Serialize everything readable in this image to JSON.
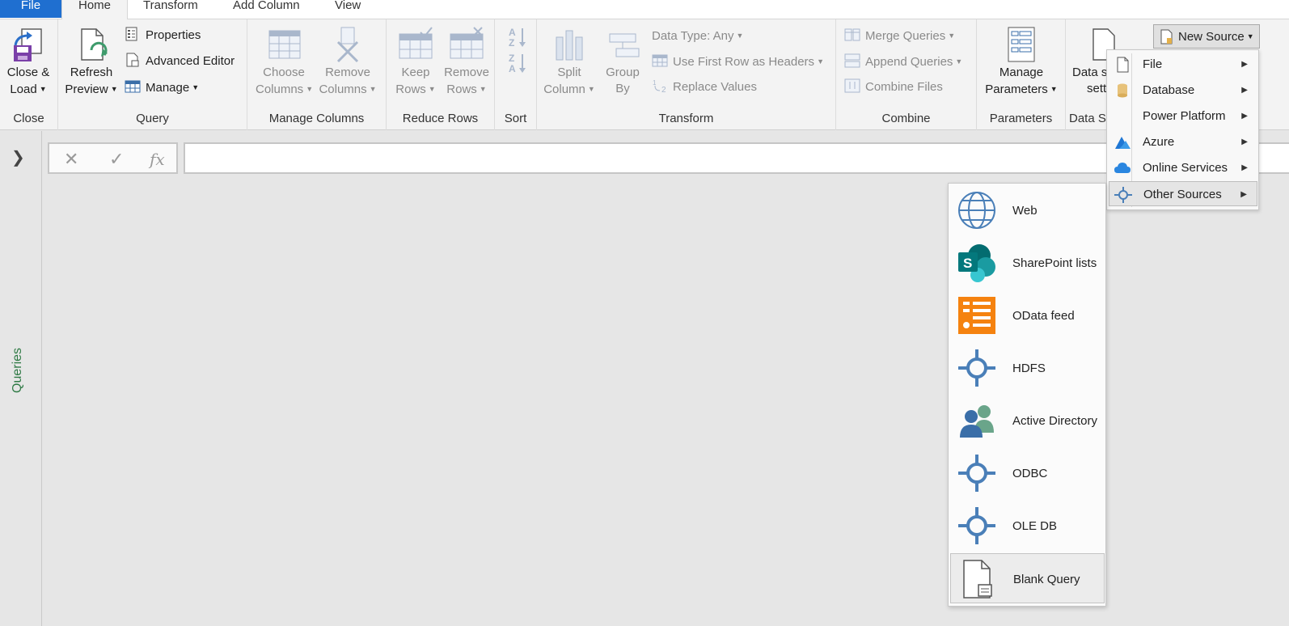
{
  "tabs": {
    "file": "File",
    "home": "Home",
    "transform": "Transform",
    "add_column": "Add Column",
    "view": "View"
  },
  "ribbon": {
    "close": {
      "button_line1": "Close &",
      "button_line2": "Load",
      "label": "Close"
    },
    "query": {
      "refresh_line1": "Refresh",
      "refresh_line2": "Preview",
      "properties": "Properties",
      "advanced_editor": "Advanced Editor",
      "manage": "Manage",
      "label": "Query"
    },
    "manage_columns": {
      "choose_line1": "Choose",
      "choose_line2": "Columns",
      "remove_line1": "Remove",
      "remove_line2": "Columns",
      "label": "Manage Columns"
    },
    "reduce_rows": {
      "keep_line1": "Keep",
      "keep_line2": "Rows",
      "remove_line1": "Remove",
      "remove_line2": "Rows",
      "label": "Reduce Rows"
    },
    "sort": {
      "label": "Sort"
    },
    "transform": {
      "split_line1": "Split",
      "split_line2": "Column",
      "group_line1": "Group",
      "group_line2": "By",
      "data_type": "Data Type: Any",
      "first_row_headers": "Use First Row as Headers",
      "replace_values": "Replace Values",
      "label": "Transform"
    },
    "combine": {
      "merge_queries": "Merge Queries",
      "append_queries": "Append Queries",
      "combine_files": "Combine Files",
      "label": "Combine"
    },
    "parameters": {
      "manage_line1": "Manage",
      "manage_line2": "Parameters",
      "label": "Parameters"
    },
    "data_sources": {
      "line1": "Data s",
      "line2": "setti",
      "label": "Data S"
    },
    "new_source": "New Source"
  },
  "queries_pane": {
    "label": "Queries"
  },
  "new_source_menu": {
    "items": [
      {
        "label": "File"
      },
      {
        "label": "Database"
      },
      {
        "label": "Power Platform"
      },
      {
        "label": "Azure"
      },
      {
        "label": "Online Services"
      },
      {
        "label": "Other Sources"
      }
    ]
  },
  "other_sources_submenu": {
    "items": [
      {
        "label": "Web"
      },
      {
        "label": "SharePoint lists"
      },
      {
        "label": "OData feed"
      },
      {
        "label": "HDFS"
      },
      {
        "label": "Active Directory"
      },
      {
        "label": "ODBC"
      },
      {
        "label": "OLE DB"
      },
      {
        "label": "Blank Query"
      }
    ]
  },
  "colors": {
    "file_tab": "#1f6fd0",
    "queries_label": "#2f7a45",
    "azure": "#1f77d4",
    "odata": "#f5820f",
    "sharepoint": "#0b7b7b",
    "connector_blue": "#4a7fb8"
  }
}
